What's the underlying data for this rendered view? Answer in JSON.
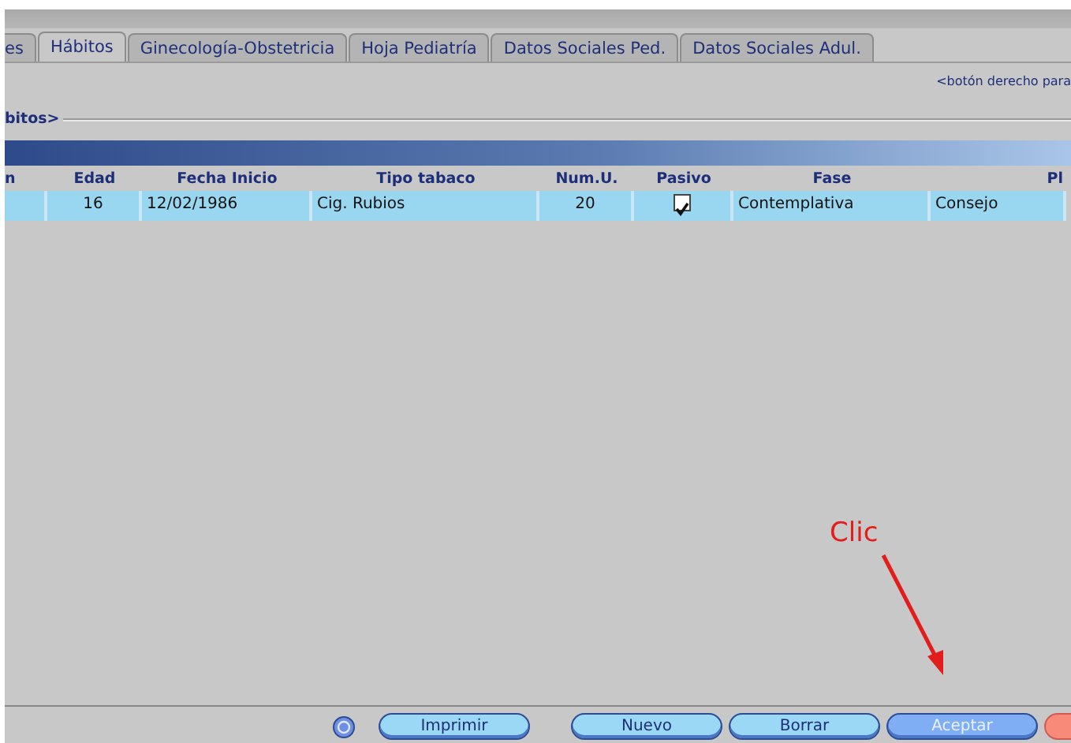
{
  "tabs": [
    {
      "label": "es",
      "selected": false
    },
    {
      "label": "Hábitos",
      "selected": true
    },
    {
      "label": "Ginecología-Obstetricia",
      "selected": false
    },
    {
      "label": "Hoja Pediatría",
      "selected": false
    },
    {
      "label": "Datos Sociales Ped.",
      "selected": false
    },
    {
      "label": "Datos Sociales Adul.",
      "selected": false
    }
  ],
  "hint": "<botón derecho para",
  "group_title": "bitos>",
  "table": {
    "columns": [
      "n",
      "Edad",
      "Fecha Inicio",
      "Tipo tabaco",
      "Num.U.",
      "Pasivo",
      "Fase",
      "Pl"
    ],
    "rows": [
      {
        "selected": true,
        "cells": [
          "",
          "16",
          "12/02/1986",
          "Cig. Rubios",
          "20",
          {
            "kind": "checkbox",
            "checked": true
          },
          "Contemplativa",
          "Consejo"
        ]
      }
    ]
  },
  "annotation": "Clic",
  "buttons": [
    {
      "label": "Imprimir",
      "kind": "normal"
    },
    {
      "label": "Nuevo",
      "kind": "normal"
    },
    {
      "label": "Borrar",
      "kind": "normal"
    },
    {
      "label": "Aceptar",
      "kind": "primary"
    },
    {
      "kind": "danger"
    }
  ]
}
